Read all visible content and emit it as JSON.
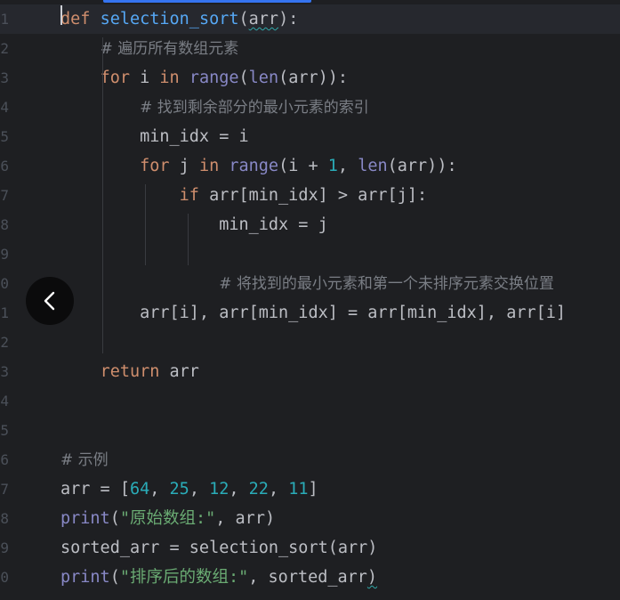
{
  "editor": {
    "language": "python",
    "colors": {
      "background": "#1e1f22",
      "keyword": "#cf8e6d",
      "function": "#56a8f5",
      "builtin": "#8888c6",
      "number": "#2aacb8",
      "string": "#6aab73",
      "comment": "#7a7e85",
      "text": "#bcbec4"
    },
    "gutter": [
      "1",
      "2",
      "3",
      "4",
      "5",
      "6",
      "7",
      "8",
      "9",
      "0",
      "1",
      "2",
      "3",
      "4",
      "5",
      "6",
      "7",
      "8",
      "9",
      "0"
    ],
    "lines": [
      [
        {
          "t": "def",
          "c": "kw"
        },
        {
          "t": " "
        },
        {
          "t": "selection_sort",
          "c": "fn"
        },
        {
          "t": "("
        },
        {
          "t": "arr",
          "c": "squiggle"
        },
        {
          "t": "):"
        }
      ],
      [
        {
          "t": "    "
        },
        {
          "t": "# 遍历所有数组元素",
          "c": "cmt"
        }
      ],
      [
        {
          "t": "    "
        },
        {
          "t": "for",
          "c": "kw"
        },
        {
          "t": " i "
        },
        {
          "t": "in",
          "c": "kw"
        },
        {
          "t": " "
        },
        {
          "t": "range",
          "c": "bi"
        },
        {
          "t": "("
        },
        {
          "t": "len",
          "c": "bi"
        },
        {
          "t": "(arr)):"
        }
      ],
      [
        {
          "t": "        "
        },
        {
          "t": "# 找到剩余部分的最小元素的索引",
          "c": "cmt"
        }
      ],
      [
        {
          "t": "        min_idx = i"
        }
      ],
      [
        {
          "t": "        "
        },
        {
          "t": "for",
          "c": "kw"
        },
        {
          "t": " j "
        },
        {
          "t": "in",
          "c": "kw"
        },
        {
          "t": " "
        },
        {
          "t": "range",
          "c": "bi"
        },
        {
          "t": "(i + "
        },
        {
          "t": "1",
          "c": "num"
        },
        {
          "t": ", "
        },
        {
          "t": "len",
          "c": "bi"
        },
        {
          "t": "(arr)):"
        }
      ],
      [
        {
          "t": "            "
        },
        {
          "t": "if",
          "c": "kw"
        },
        {
          "t": " arr[min_idx] > arr[j]:"
        }
      ],
      [
        {
          "t": "                min_idx = j"
        }
      ],
      [
        {
          "t": ""
        }
      ],
      [
        {
          "t": "                "
        },
        {
          "t": "# 将找到的最小元素和第一个未排序元素交换位置",
          "c": "cmt"
        }
      ],
      [
        {
          "t": "        arr[i], arr[min_idx] = arr[min_idx], arr[i]"
        }
      ],
      [
        {
          "t": ""
        }
      ],
      [
        {
          "t": "    "
        },
        {
          "t": "return",
          "c": "kw"
        },
        {
          "t": " arr"
        }
      ],
      [
        {
          "t": ""
        }
      ],
      [
        {
          "t": ""
        }
      ],
      [
        {
          "t": "# 示例",
          "c": "cmt"
        }
      ],
      [
        {
          "t": "arr = ["
        },
        {
          "t": "64",
          "c": "num"
        },
        {
          "t": ", "
        },
        {
          "t": "25",
          "c": "num"
        },
        {
          "t": ", "
        },
        {
          "t": "12",
          "c": "num"
        },
        {
          "t": ", "
        },
        {
          "t": "22",
          "c": "num"
        },
        {
          "t": ", "
        },
        {
          "t": "11",
          "c": "num"
        },
        {
          "t": "]"
        }
      ],
      [
        {
          "t": "print",
          "c": "bi"
        },
        {
          "t": "("
        },
        {
          "t": "\"原始数组:\"",
          "c": "str"
        },
        {
          "t": ", arr)"
        }
      ],
      [
        {
          "t": "sorted_arr = selection_sort(arr)"
        }
      ],
      [
        {
          "t": "print",
          "c": "bi"
        },
        {
          "t": "("
        },
        {
          "t": "\"排序后的数组:\"",
          "c": "str"
        },
        {
          "t": ", sorted_arr"
        },
        {
          "t": ")",
          "c": "squiggle"
        }
      ]
    ],
    "current_line": 1
  },
  "overlay": {
    "back_icon": "chevron-left-icon"
  }
}
